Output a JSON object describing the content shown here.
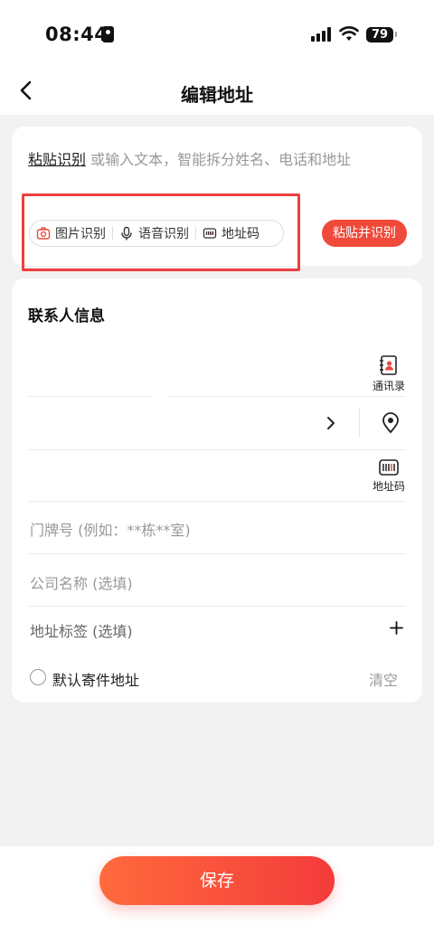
{
  "status_bar": {
    "time": "08:44",
    "battery": "79"
  },
  "nav": {
    "title": "编辑地址"
  },
  "paste_card": {
    "paste_link": "粘贴识别",
    "hint": "或输入文本，智能拆分姓名、电话和地址",
    "tools": [
      {
        "label": "图片识别",
        "icon": "camera-icon"
      },
      {
        "label": "语音识别",
        "icon": "microphone-icon"
      },
      {
        "label": "地址码",
        "icon": "address-code-icon"
      }
    ],
    "paste_button": "粘贴并识别"
  },
  "contact_card": {
    "title": "联系人信息",
    "contacts_label": "通讯录",
    "address_code_label": "地址码",
    "house_number_placeholder": "门牌号 (例如：**栋**室)",
    "company_placeholder": "公司名称 (选填)",
    "tag_label": "地址标签 (选填)",
    "default_label": "默认寄件地址",
    "clear_label": "清空"
  },
  "footer": {
    "save_label": "保存"
  },
  "colors": {
    "accent": "#f04a3a",
    "highlight_border": "#ee3e3e"
  }
}
